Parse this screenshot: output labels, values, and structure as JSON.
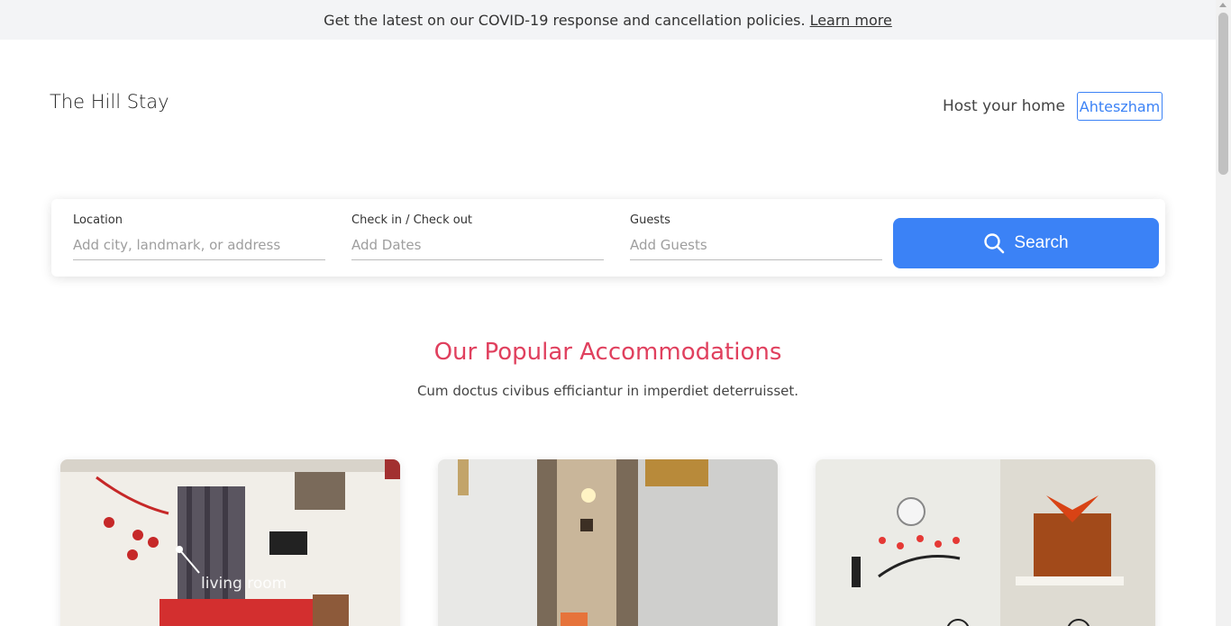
{
  "banner": {
    "text": "Get the latest on our COVID-19 response and cancellation policies.",
    "link": "Learn more"
  },
  "header": {
    "brand": "The Hill Stay",
    "host_link": "Host your home",
    "user_button": "Ahteszham"
  },
  "search": {
    "location": {
      "label": "Location",
      "placeholder": "Add city, landmark, or address"
    },
    "dates": {
      "label": "Check in / Check out",
      "placeholder": "Add Dates"
    },
    "guests": {
      "label": "Guests",
      "placeholder": "Add Guests"
    },
    "button": "Search"
  },
  "section": {
    "title": "Our Popular Accommodations",
    "subtitle": "Cum doctus civibus efficiantur in imperdiet deterruisset."
  },
  "cards": [
    {
      "photo_tag": "living room"
    },
    {
      "photo_tag": ""
    },
    {
      "photo_tag": ""
    }
  ],
  "colors": {
    "accent_blue": "#3b82f6",
    "title_pink": "#e0405e",
    "banner_bg": "#f3f4f6"
  }
}
